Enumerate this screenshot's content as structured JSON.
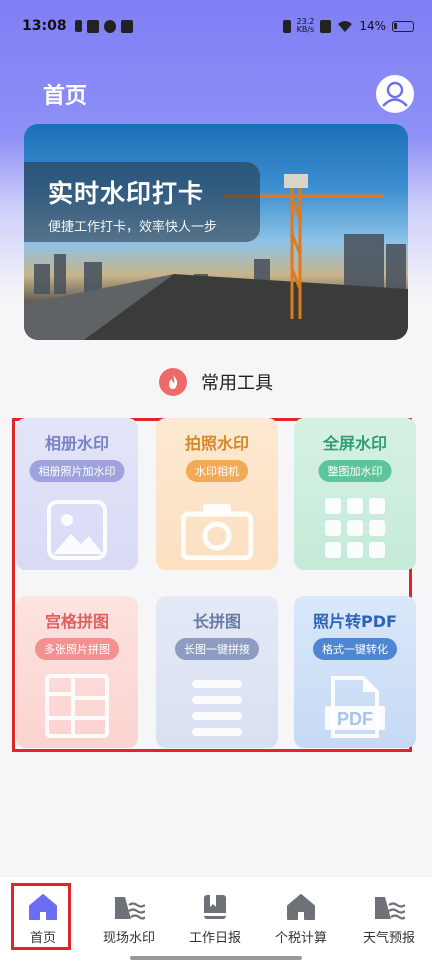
{
  "status_bar": {
    "time": "13:08",
    "net_speed_value": "23.2",
    "net_speed_unit": "KB/s",
    "battery": "14%"
  },
  "header": {
    "title": "首页"
  },
  "banner": {
    "title": "实时水印打卡",
    "subtitle": "便捷工作打卡，效率快人一步"
  },
  "section": {
    "title": "常用工具"
  },
  "tools": [
    {
      "title": "相册水印",
      "badge": "相册照片加水印",
      "icon": "image-icon",
      "title_color": "#7a80c9",
      "badge_color": "#9ea3dd",
      "bg": "#e6e6f7"
    },
    {
      "title": "拍照水印",
      "badge": "水印相机",
      "icon": "camera-icon",
      "title_color": "#d7882a",
      "badge_color": "#f1aa55",
      "bg": "#fdebd6"
    },
    {
      "title": "全屏水印",
      "badge": "整图加水印",
      "icon": "grid-icon",
      "title_color": "#2f9e70",
      "badge_color": "#5ec59a",
      "bg": "#d8f1e6"
    },
    {
      "title": "宫格拼图",
      "badge": "多张照片拼图",
      "icon": "collage-icon",
      "title_color": "#e06161",
      "badge_color": "#f39090",
      "bg": "#fde1df"
    },
    {
      "title": "长拼图",
      "badge": "长图一键拼接",
      "icon": "long-image-icon",
      "title_color": "#6a7ba8",
      "badge_color": "#8e9cc3",
      "bg": "#e2e8f5"
    },
    {
      "title": "照片转PDF",
      "badge": "格式一键转化",
      "icon": "pdf-icon",
      "title_color": "#2d63b8",
      "badge_color": "#4f86d4",
      "bg": "#d6e5f8"
    }
  ],
  "bottom_nav": [
    {
      "label": "首页",
      "icon": "home-icon",
      "active": true
    },
    {
      "label": "现场水印",
      "icon": "waves-icon"
    },
    {
      "label": "工作日报",
      "icon": "book-icon"
    },
    {
      "label": "个税计算",
      "icon": "house-icon"
    },
    {
      "label": "天气预报",
      "icon": "waves-icon"
    }
  ],
  "colors": {
    "accent": "#6b6ef2",
    "highlight_border": "#e0262b"
  }
}
